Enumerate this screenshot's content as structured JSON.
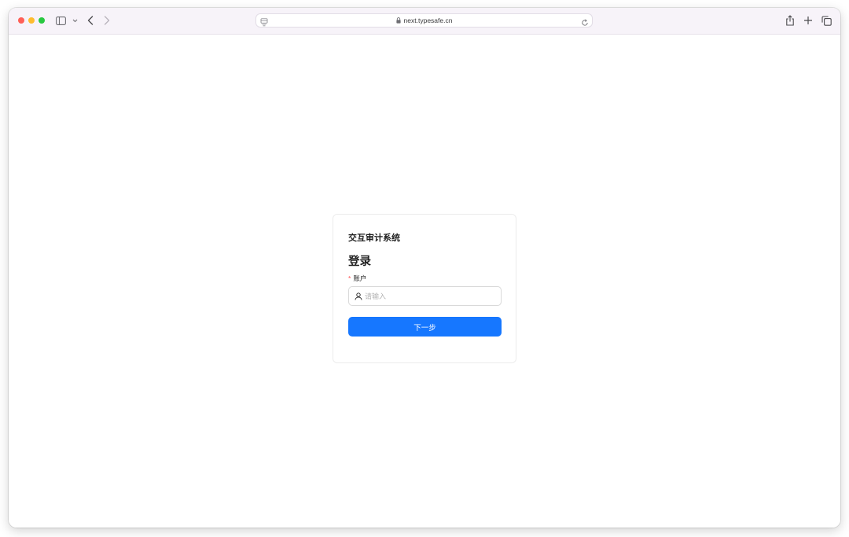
{
  "browser": {
    "url": "next.typesafe.cn",
    "icons": {
      "close": "close-dot",
      "minimize": "minimize-dot",
      "maximize": "maximize-dot",
      "sidebar": "sidebar-icon",
      "sidebar_menu": "chevron-down-icon",
      "back": "back-arrow-icon",
      "forward": "forward-arrow-icon",
      "tab_page": "page-icon",
      "lock": "lock-icon",
      "reload": "reload-icon",
      "share": "share-icon",
      "new_tab": "plus-icon",
      "tabs_overview": "tabs-icon"
    },
    "colors": {
      "close": "#ff5f57",
      "minimize": "#febc2e",
      "maximize": "#28c840",
      "toolbar_bg": "#f7f3f9"
    }
  },
  "login": {
    "system_title": "交互审计系统",
    "heading": "登录",
    "account_required_mark": "*",
    "account_label": "账户",
    "account_value": "",
    "account_placeholder": "请输入",
    "next_button": "下一步"
  },
  "theme": {
    "primary": "#1677ff",
    "required": "#ff4d4f"
  }
}
